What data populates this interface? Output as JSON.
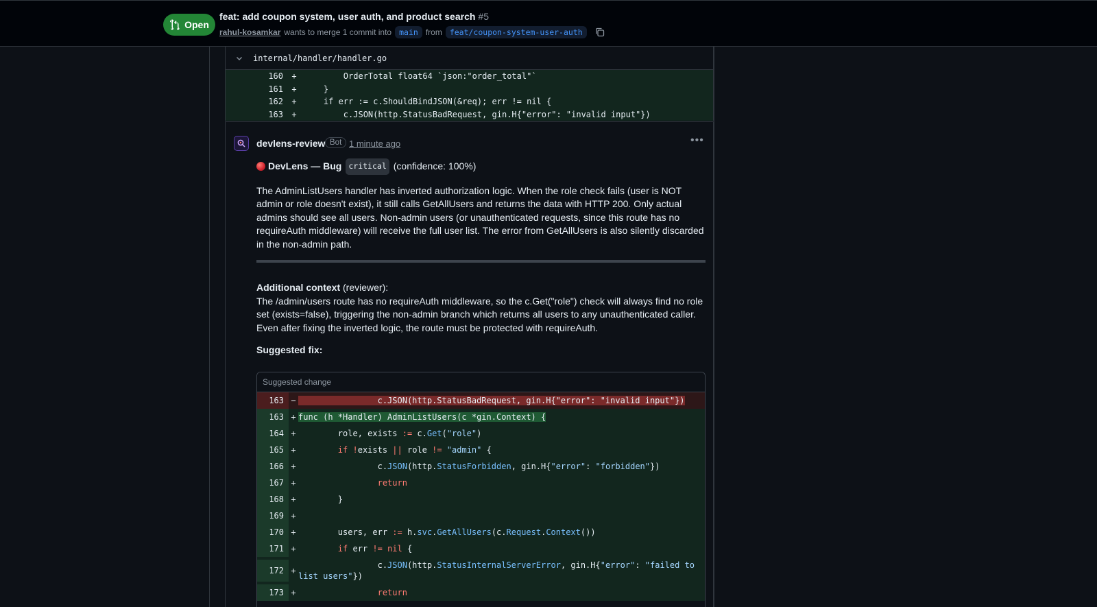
{
  "pr": {
    "state": "Open",
    "title": "feat: add coupon system, user auth, and product search",
    "number": "#5",
    "author": "rahul-kosamkar",
    "merge_text": "wants to merge 1 commit into",
    "base_branch": "main",
    "from_text": "from",
    "head_branch": "feat/coupon-system-user-auth"
  },
  "file": {
    "path": "internal/handler/handler.go",
    "lines": [
      {
        "ln": "160",
        "mk": "+",
        "code": "        OrderTotal float64 `json:\"order_total\"`"
      },
      {
        "ln": "161",
        "mk": "+",
        "code": "    }"
      },
      {
        "ln": "162",
        "mk": "+",
        "code": "    if err := c.ShouldBindJSON(&req); err != nil {"
      },
      {
        "ln": "163",
        "mk": "+",
        "code": "        c.JSON(http.StatusBadRequest, gin.H{\"error\": \"invalid input\"})"
      }
    ]
  },
  "comment": {
    "author": "devlens-review",
    "badge": "Bot",
    "time": "1 minute ago",
    "severity_prefix": "DevLens — Bug",
    "severity_chip": "critical",
    "confidence": "(confidence: 100%)",
    "body": "The AdminListUsers handler has inverted authorization logic. When the role check fails (user is NOT admin or role doesn't exist), it still calls GetAllUsers and returns the data with HTTP 200. Only actual admins should see all users. Non-admin users (or unauthenticated requests, since this route has no requireAuth middleware) will receive the full user list. The error from GetAllUsers is also silently discarded in the non-admin path.",
    "context_label": "Additional context",
    "context_suffix": "(reviewer):",
    "context_body": "The /admin/users route has no requireAuth middleware, so the c.Get(\"role\") check will always find no role set (exists=false), triggering the non-admin branch which returns all users to any unauthenticated caller. Even after fixing the inverted logic, the route must be protected with requireAuth.",
    "fix_label": "Suggested fix:",
    "suggestion_header": "Suggested change"
  }
}
